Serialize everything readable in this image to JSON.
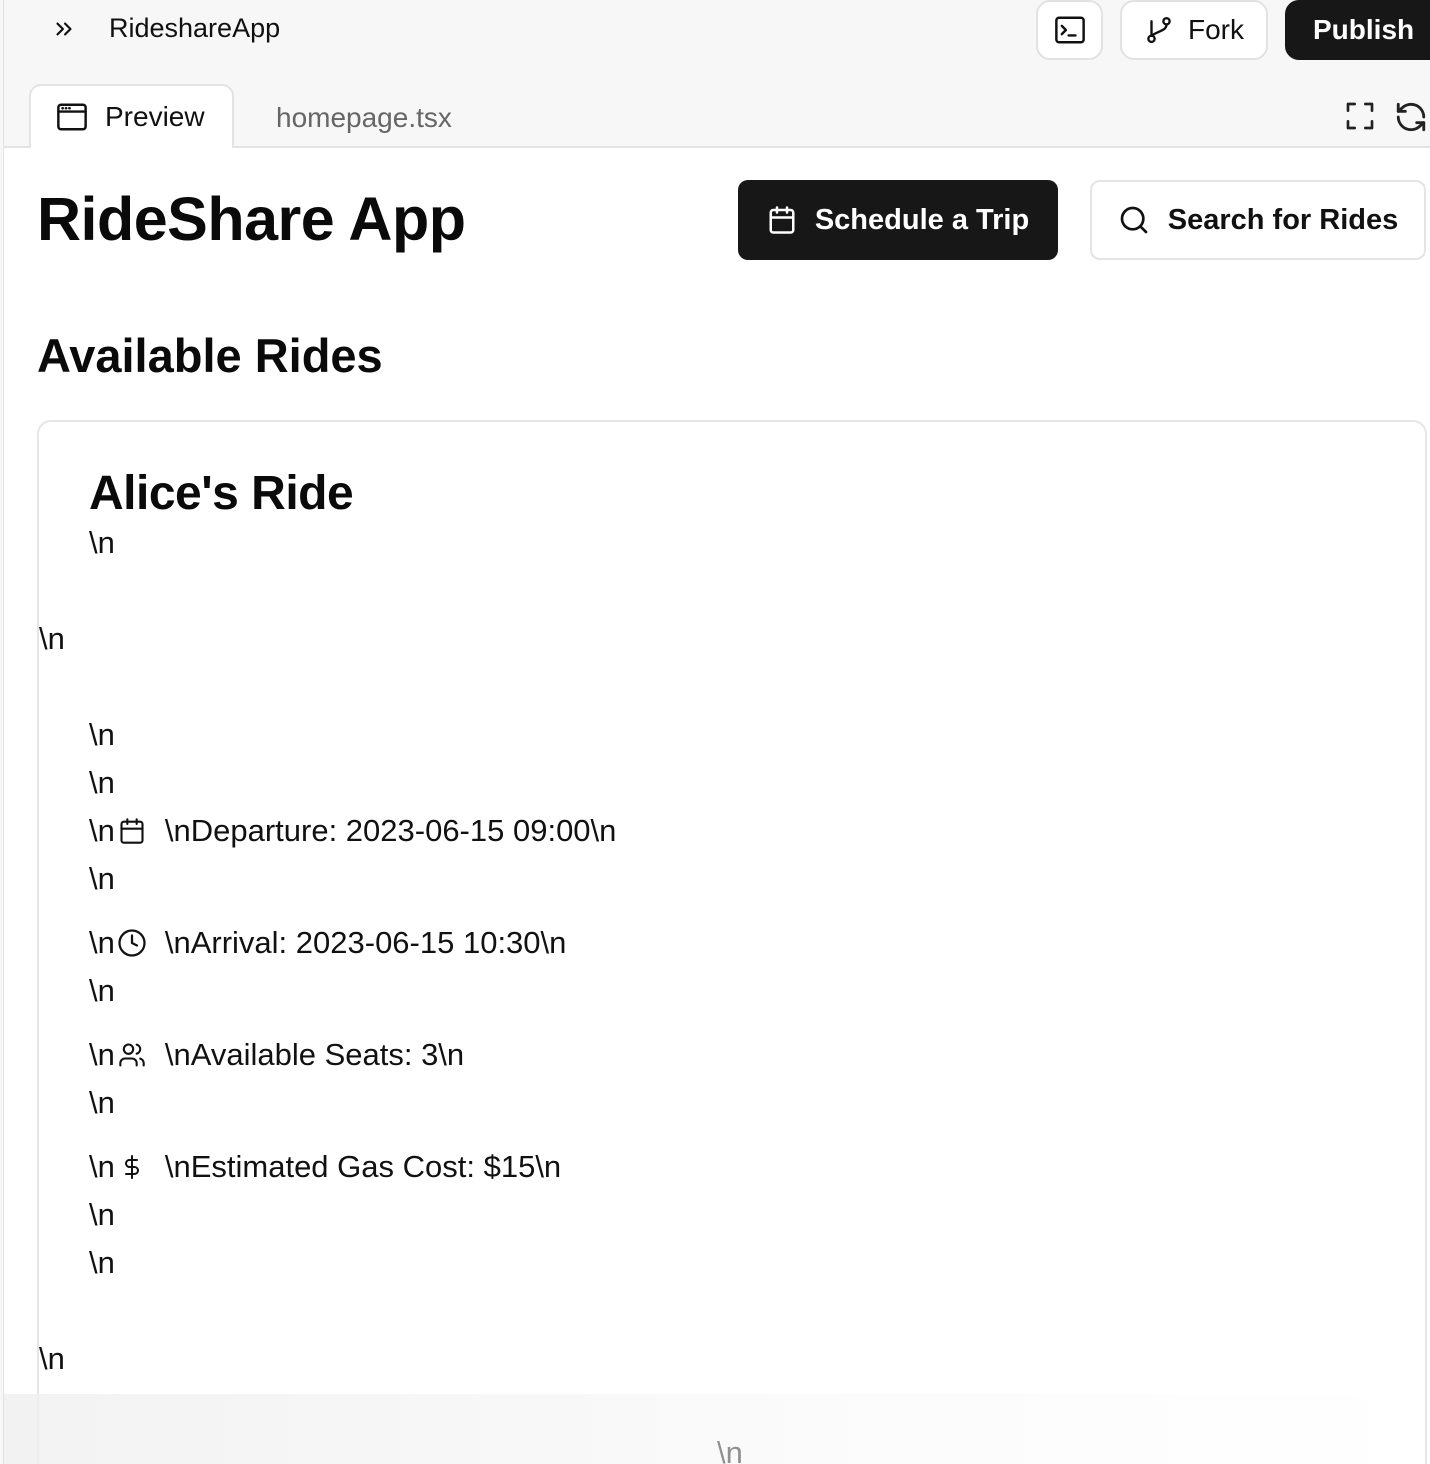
{
  "topbar": {
    "app_name": "RideshareApp",
    "expand_icon": "chevrons-right-icon",
    "terminal_icon": "terminal-icon",
    "fork_label": "Fork",
    "fork_icon": "git-fork-icon",
    "publish_label": "Publish"
  },
  "tabs": [
    {
      "label": "Preview",
      "icon": "browser-window-icon",
      "active": true
    },
    {
      "label": "homepage.tsx",
      "active": false
    }
  ],
  "tools": {
    "fullscreen_icon": "fullscreen-icon",
    "refresh_icon": "refresh-icon"
  },
  "page": {
    "title": "RideShare App",
    "schedule_button": "Schedule a Trip",
    "search_button": "Search for Rides",
    "section_title": "Available Rides"
  },
  "ride": {
    "title": "Alice's Ride",
    "newline": "\\n",
    "departure_prefix": "\\n",
    "departure_text": "\\nDeparture: 2023-06-15 09:00\\n",
    "arrival_prefix": "\\n",
    "arrival_text": "\\nArrival: 2023-06-15 10:30\\n",
    "seats_prefix": "\\n",
    "seats_text": "\\nAvailable Seats: 3\\n",
    "gas_prefix": "\\n",
    "gas_text": "\\nEstimated Gas Cost: $15\\n"
  },
  "colors": {
    "primary": "#171717",
    "border": "#e4e4e4",
    "muted_text": "#666666"
  }
}
